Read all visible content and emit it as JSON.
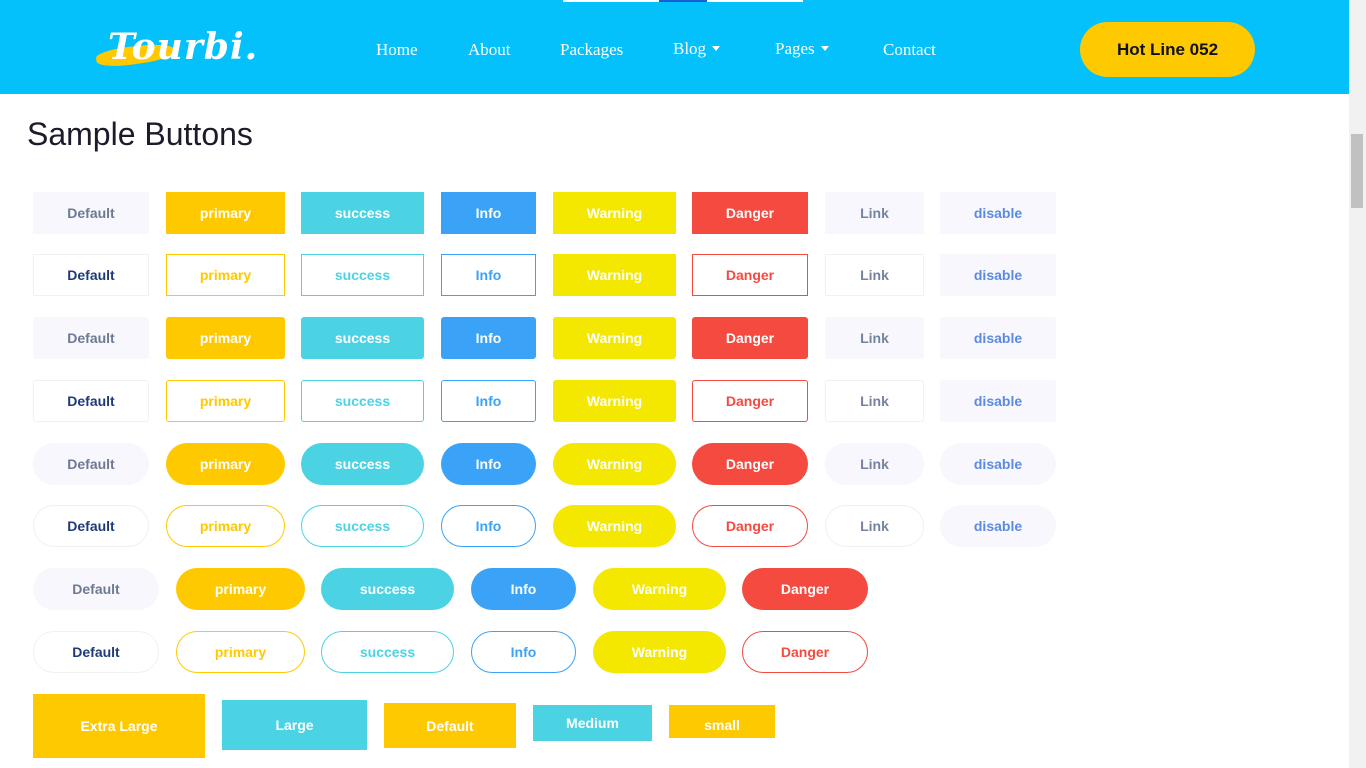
{
  "nav": {
    "logo_text": "Tourbi.",
    "links": [
      {
        "label": "Home",
        "has_caret": false
      },
      {
        "label": "About",
        "has_caret": false
      },
      {
        "label": "Packages",
        "has_caret": false
      },
      {
        "label": "Blog",
        "has_caret": true
      },
      {
        "label": "Pages",
        "has_caret": true
      },
      {
        "label": "Contact",
        "has_caret": false
      }
    ],
    "hotline_label": "Hot Line 052"
  },
  "page": {
    "title": "Sample Buttons"
  },
  "button_rows": [
    {
      "style": "solid",
      "shape": "square",
      "labels": [
        "Default",
        "primary",
        "success",
        "Info",
        "Warning",
        "Danger",
        "Link",
        "disable"
      ]
    },
    {
      "style": "outline",
      "shape": "square",
      "labels": [
        "Default",
        "primary",
        "success",
        "Info",
        "Warning",
        "Danger",
        "Link",
        "disable"
      ]
    },
    {
      "style": "solid",
      "shape": "rounded",
      "labels": [
        "Default",
        "primary",
        "success",
        "Info",
        "Warning",
        "Danger",
        "Link",
        "disable"
      ]
    },
    {
      "style": "outline",
      "shape": "rounded",
      "labels": [
        "Default",
        "primary",
        "success",
        "Info",
        "Warning",
        "Danger",
        "Link",
        "disable"
      ]
    },
    {
      "style": "solid",
      "shape": "pill",
      "labels": [
        "Default",
        "primary",
        "success",
        "Info",
        "Warning",
        "Danger",
        "Link",
        "disable"
      ]
    },
    {
      "style": "outline",
      "shape": "pill",
      "labels": [
        "Default",
        "primary",
        "success",
        "Info",
        "Warning",
        "Danger",
        "Link",
        "disable"
      ]
    },
    {
      "style": "solid",
      "shape": "pill",
      "labels": [
        "Default",
        "primary",
        "success",
        "Info",
        "Warning",
        "Danger"
      ]
    },
    {
      "style": "outline",
      "shape": "pill",
      "labels": [
        "Default",
        "primary",
        "success",
        "Info",
        "Warning",
        "Danger"
      ]
    }
  ],
  "size_buttons": [
    "Extra Large",
    "Large",
    "Default",
    "Medium",
    "small"
  ],
  "colors": {
    "navbar": "#04c1fb",
    "primary": "#ffc900",
    "success": "#4bd3e4",
    "info": "#3aa3f7",
    "warning": "#f4e700",
    "danger": "#f44a40"
  }
}
